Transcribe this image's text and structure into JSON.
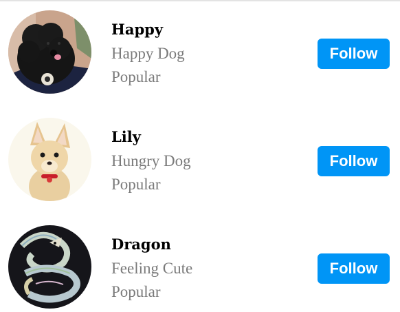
{
  "users": [
    {
      "name": "Happy",
      "bio": "Happy Dog",
      "status": "Popular",
      "follow_label": "Follow",
      "avatar_icon": "black-poodle-avatar"
    },
    {
      "name": "Lily",
      "bio": "Hungry Dog",
      "status": "Popular",
      "follow_label": "Follow",
      "avatar_icon": "chihuahua-avatar"
    },
    {
      "name": "Dragon",
      "bio": "Feeling Cute",
      "status": "Popular",
      "follow_label": "Follow",
      "avatar_icon": "dragon-drawing-avatar"
    }
  ],
  "colors": {
    "follow_button": "#0095f6",
    "follow_text": "#ffffff",
    "secondary_text": "#7a7a7a",
    "divider": "#e3e3e3"
  }
}
